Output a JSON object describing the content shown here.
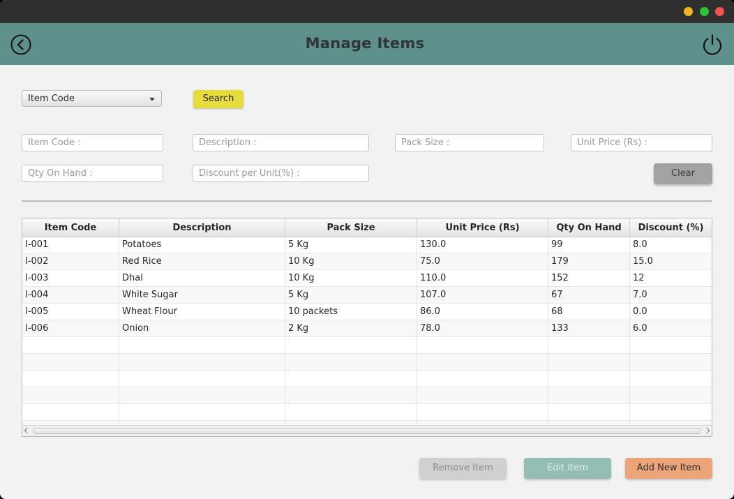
{
  "window": {
    "controls": {
      "minimize_color": "#f5b325",
      "maximize_color": "#2ec332",
      "close_color": "#f0544c"
    }
  },
  "header": {
    "title": "Manage Items",
    "back_icon": "back-arrow-circle-icon",
    "power_icon": "power-icon",
    "background_color": "#5e918b"
  },
  "search": {
    "filter_selected": "Item Code",
    "search_label": "Search",
    "search_color": "#e6dc3c"
  },
  "form": {
    "item_code_placeholder": "Item Code :",
    "description_placeholder": "Description :",
    "pack_size_placeholder": "Pack Size :",
    "unit_price_placeholder": "Unit Price (Rs) :",
    "qty_on_hand_placeholder": "Qty On Hand :",
    "discount_placeholder": "Discount per Unit(%) :",
    "clear_label": "Clear"
  },
  "table": {
    "columns": [
      "Item Code",
      "Description",
      "Pack Size",
      "Unit Price (Rs)",
      "Qty On Hand",
      "Discount (%)"
    ],
    "rows": [
      [
        "I-001",
        "Potatoes",
        "5 Kg",
        "130.0",
        "99",
        "8.0"
      ],
      [
        "I-002",
        "Red Rice",
        "10 Kg",
        "75.0",
        "179",
        "15.0"
      ],
      [
        "I-003",
        "Dhal",
        "10 Kg",
        "110.0",
        "152",
        "12"
      ],
      [
        "I-004",
        "White Sugar",
        "5 Kg",
        "107.0",
        "67",
        "7.0"
      ],
      [
        "I-005",
        "Wheat Flour",
        "10 packets",
        "86.0",
        "68",
        "0.0"
      ],
      [
        "I-006",
        "Onion",
        "2 Kg",
        "78.0",
        "133",
        "6.0"
      ]
    ]
  },
  "actions": {
    "remove_label": "Remove Item",
    "edit_label": "Edit Item",
    "add_label": "Add New Item",
    "remove_color": "#d0d0d0",
    "edit_color": "#94bdb6",
    "add_color": "#eca578"
  }
}
